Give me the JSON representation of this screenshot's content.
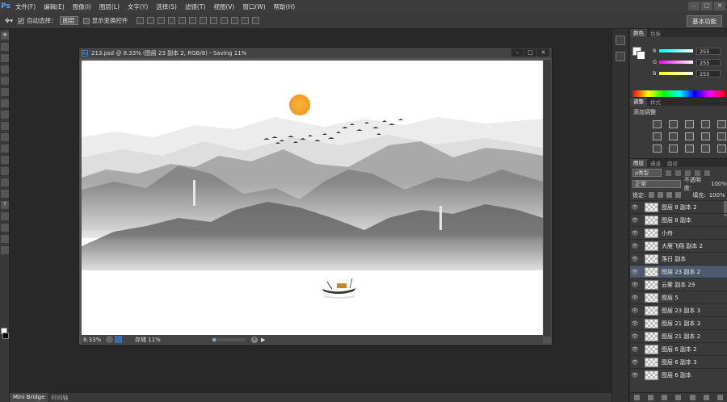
{
  "app": {
    "logo": "Ps"
  },
  "menu": [
    "文件(F)",
    "编辑(E)",
    "图像(I)",
    "图层(L)",
    "文字(Y)",
    "选择(S)",
    "滤镜(T)",
    "视图(V)",
    "窗口(W)",
    "帮助(H)"
  ],
  "window_buttons": [
    "–",
    "□",
    "✕"
  ],
  "options": {
    "tool_icon": "move-tool-icon",
    "auto_select_label": "自动选择：",
    "auto_select_value": "图层",
    "show_transform_label": "显示变换控件",
    "workspace": "基本功能"
  },
  "document": {
    "title": "213.psd @ 8.33% (图层 23 副本 2, RGB/8) - Saving 11%",
    "ps_badge": "Ps",
    "buttons": [
      "–",
      "□",
      "✕"
    ],
    "zoom": "8.33%",
    "save_status": "存储  11%",
    "progress_fraction": 0.11
  },
  "color_panel": {
    "tabs": [
      "颜色",
      "色板"
    ],
    "channels": [
      {
        "label": "R",
        "value": "255"
      },
      {
        "label": "G",
        "value": "255"
      },
      {
        "label": "B",
        "value": "255"
      }
    ],
    "foreground": "#ffffff",
    "background": "#ffffff"
  },
  "adjustments_panel": {
    "tabs": [
      "调整",
      "样式"
    ],
    "title": "添加调整"
  },
  "layers_panel": {
    "tabs": [
      "图层",
      "通道",
      "路径"
    ],
    "filter_kind": "ρ类型",
    "blend_mode": "正常",
    "opacity_label": "不透明度:",
    "opacity_value": "100%",
    "lock_label": "锁定:",
    "fill_label": "填充:",
    "fill_value": "100%",
    "layers": [
      {
        "name": "图层 8 副本 2",
        "selected": false
      },
      {
        "name": "图层 8 副本",
        "selected": false
      },
      {
        "name": "小舟",
        "selected": false
      },
      {
        "name": "大雁飞翔 副本 2",
        "selected": false
      },
      {
        "name": "落日 副本",
        "selected": false
      },
      {
        "name": "图层 23 副本 2",
        "selected": true
      },
      {
        "name": "云雾 副本 29",
        "selected": false
      },
      {
        "name": "图层 5",
        "selected": false
      },
      {
        "name": "图层 23 副本 3",
        "selected": false
      },
      {
        "name": "图层 21 副本 3",
        "selected": false
      },
      {
        "name": "图层 21 副本 2",
        "selected": false
      },
      {
        "name": "图层 6 副本 2",
        "selected": false
      },
      {
        "name": "图层 6 副本 3",
        "selected": false
      },
      {
        "name": "图层 6 副本",
        "selected": false
      }
    ],
    "footer_icons": [
      "link-icon",
      "fx-icon",
      "mask-icon",
      "adjustment-icon",
      "folder-icon",
      "new-layer-icon",
      "trash-icon"
    ]
  },
  "bottom_tabs": [
    "Mini Bridge",
    "时间轴"
  ],
  "colors": {
    "accent": "#4d5a6d",
    "sun": "#f4a62a"
  }
}
